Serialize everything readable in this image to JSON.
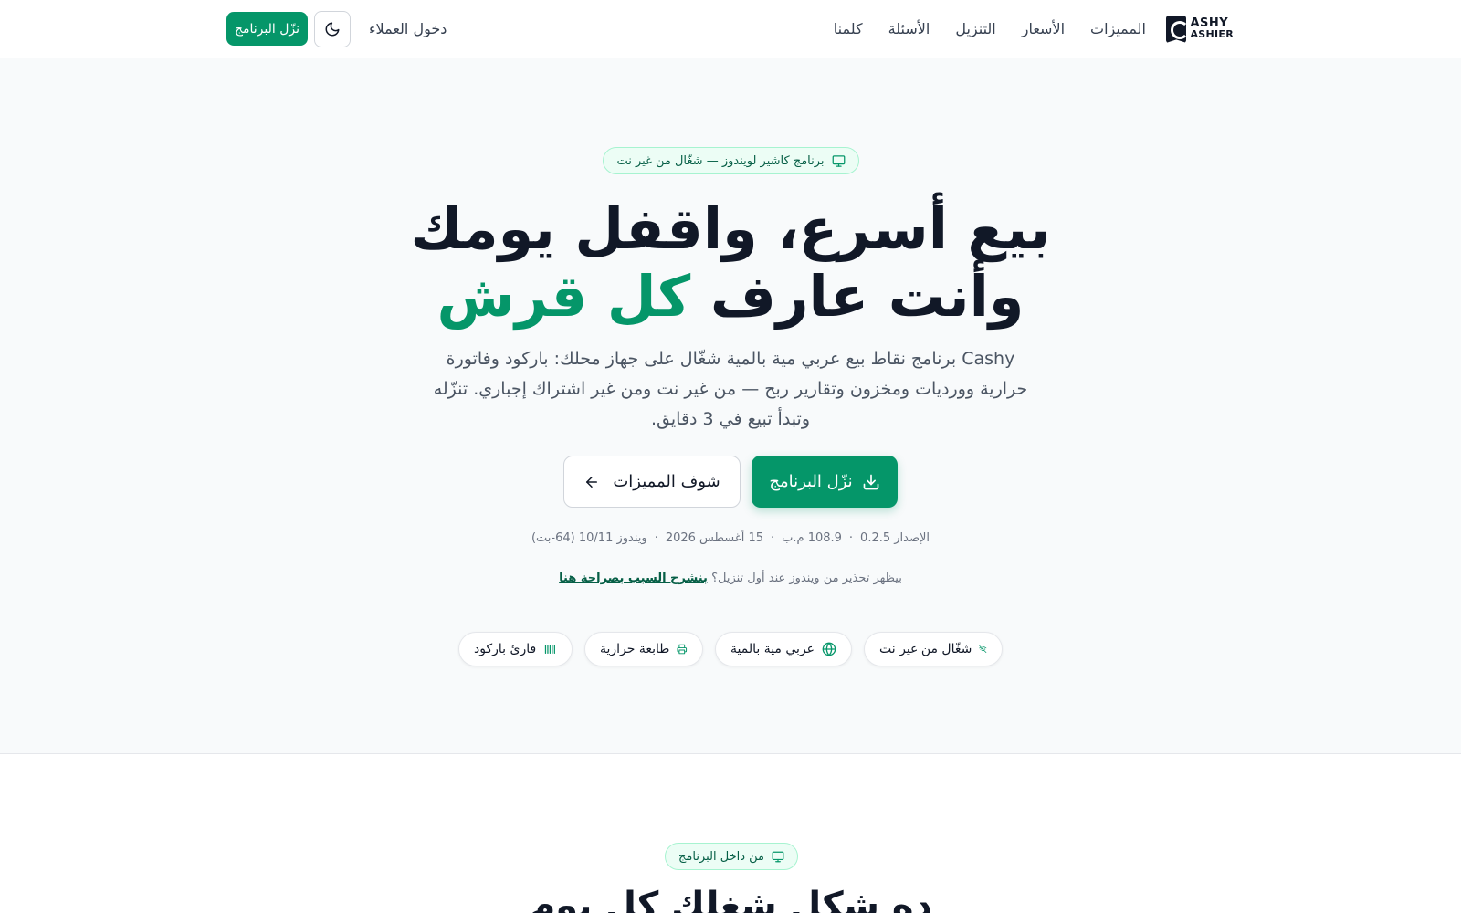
{
  "colors": {
    "accent": "#059669",
    "accent_light": "#ecfdf5",
    "text": "#111827",
    "muted": "#6b7280"
  },
  "header": {
    "logo": {
      "line1": "ASHY",
      "line2": "ASHIER",
      "icon": "cashy-logo-icon"
    },
    "nav": [
      "المميزات",
      "الأسعار",
      "التنزيل",
      "الأسئلة",
      "كلمنا"
    ],
    "login": "دخول العملاء",
    "theme_icon": "moon-icon",
    "cta": "نزّل البرنامج"
  },
  "hero": {
    "badge": "برنامج كاشير لويندوز — شغّال من غير نت",
    "badge_icon": "monitor-icon",
    "title_line1": "بيع أسرع، واقفل يومك",
    "title_line2_prefix": "وأنت عارف",
    "title_line2_highlight": "كل قرش",
    "description": "Cashy برنامج نقاط بيع عربي مية بالمية شغّال على جهاز محلك: باركود وفاتورة حرارية وورديات ومخزون وتقارير ربح — من غير نت ومن غير اشتراك إجباري. تنزّله وتبدأ تبيع في 3 دقايق.",
    "primary_button": "نزّل البرنامج",
    "primary_icon": "download-icon",
    "secondary_button": "شوف المميزات",
    "secondary_icon": "arrow-left-icon",
    "meta": {
      "version": "الإصدار 0.2.5",
      "size": "108.9 م.ب",
      "date": "15 أغسطس 2026",
      "os": "ويندوز 10/11 (64-بت)"
    },
    "warning_text": "بيظهر تحذير من ويندوز عند أول تنزيل؟",
    "warning_link": "بنشرح السبب بصراحة هنا",
    "chips": [
      {
        "label": "شغّال من غير نت",
        "icon": "wifi-off-icon"
      },
      {
        "label": "عربي مية بالمية",
        "icon": "globe-icon"
      },
      {
        "label": "طابعة حرارية",
        "icon": "printer-icon"
      },
      {
        "label": "قارئ باركود",
        "icon": "barcode-icon"
      }
    ]
  },
  "section2": {
    "badge": "من داخل البرنامج",
    "badge_icon": "monitor-icon",
    "title": "ده شكل شغلك كل يوم"
  }
}
